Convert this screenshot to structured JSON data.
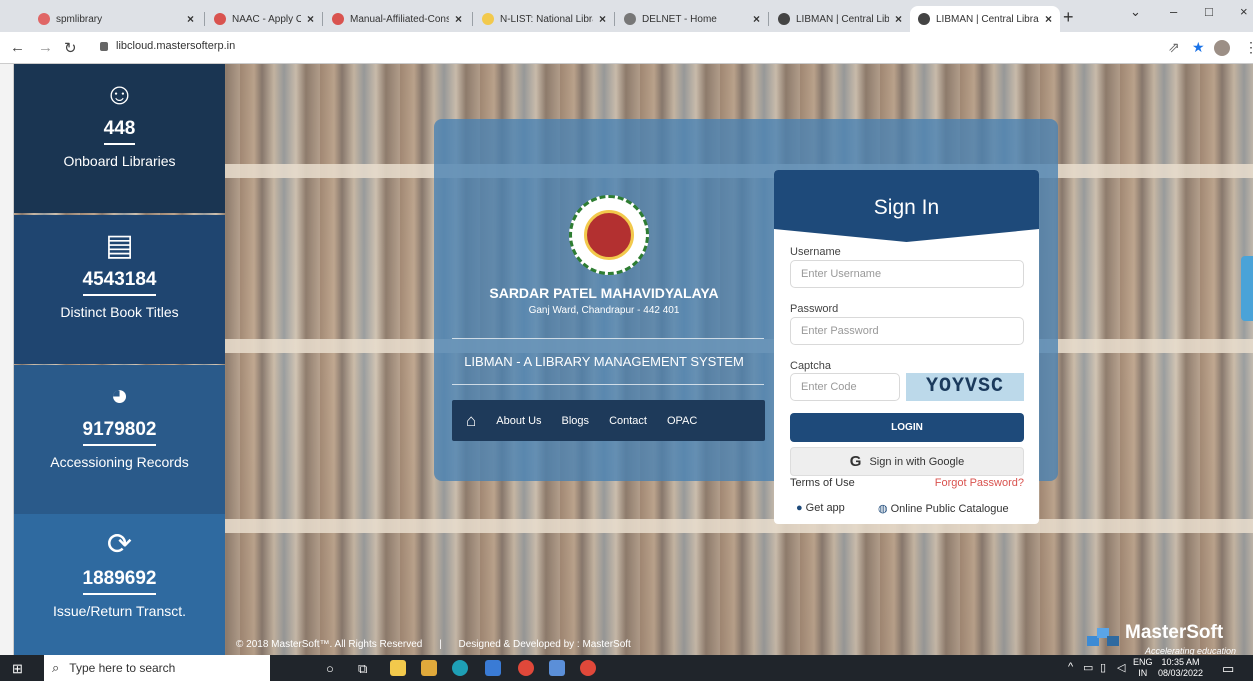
{
  "browser": {
    "tabs": [
      {
        "title": "spmlibrary",
        "color": "#e06666"
      },
      {
        "title": "NAAC - Apply Online",
        "color": "#d9534f"
      },
      {
        "title": "Manual-Affiliated-Cons",
        "color": "#d9534f"
      },
      {
        "title": "N-LIST: National Library",
        "color": "#f2c94c"
      },
      {
        "title": "DELNET - Home",
        "color": "#777777"
      },
      {
        "title": "LIBMAN | Central Librar",
        "color": "#444444"
      },
      {
        "title": "LIBMAN | Central Librar",
        "color": "#444444"
      }
    ],
    "url": "libcloud.mastersofterp.in"
  },
  "stats": [
    {
      "icon": "smiley-icon",
      "glyph": "☺",
      "value": "448",
      "label": "Onboard Libraries",
      "bg": "#1a3552"
    },
    {
      "icon": "book-icon",
      "glyph": "▤",
      "value": "4543184",
      "label": "Distinct Book Titles",
      "bg": "#1f4570"
    },
    {
      "icon": "pie-chart-icon",
      "glyph": "◕",
      "value": "9179802",
      "label": "Accessioning Records",
      "bg": "#2a5a8a"
    },
    {
      "icon": "refresh-icon",
      "glyph": "⟳",
      "value": "1889692",
      "label": "Issue/Return Transct.",
      "bg": "#2f6aa0"
    }
  ],
  "college": {
    "name": "SARDAR PATEL MAHAVIDYALAYA",
    "address": "Ganj Ward, Chandrapur - 442 401",
    "system": "LIBMAN - A LIBRARY MANAGEMENT SYSTEM"
  },
  "nav": {
    "links": [
      "About Us",
      "Blogs",
      "Contact",
      "OPAC"
    ]
  },
  "signin": {
    "title": "Sign In",
    "username_label": "Username",
    "username_placeholder": "Enter Username",
    "password_label": "Password",
    "password_placeholder": "Enter Password",
    "captcha_label": "Captcha",
    "captcha_placeholder": "Enter Code",
    "captcha_code": "YOYVSC",
    "login_button": "LOGIN",
    "google_button": "Sign in with Google",
    "terms": "Terms of Use",
    "forgot": "Forgot Password?",
    "get_app": "Get app",
    "opac": "Online Public Catalogue"
  },
  "footer": {
    "copyright": "© 2018 MasterSoft™. All Rights Reserved",
    "separator": "|",
    "designed": "Designed & Developed by : MasterSoft"
  },
  "brand": {
    "name": "MasterSoft",
    "tagline": "Accelerating education"
  },
  "taskbar": {
    "search_placeholder": "Type here to search",
    "lang_top": "ENG",
    "lang_bottom": "IN",
    "time": "10:35 AM",
    "date": "08/03/2022"
  }
}
